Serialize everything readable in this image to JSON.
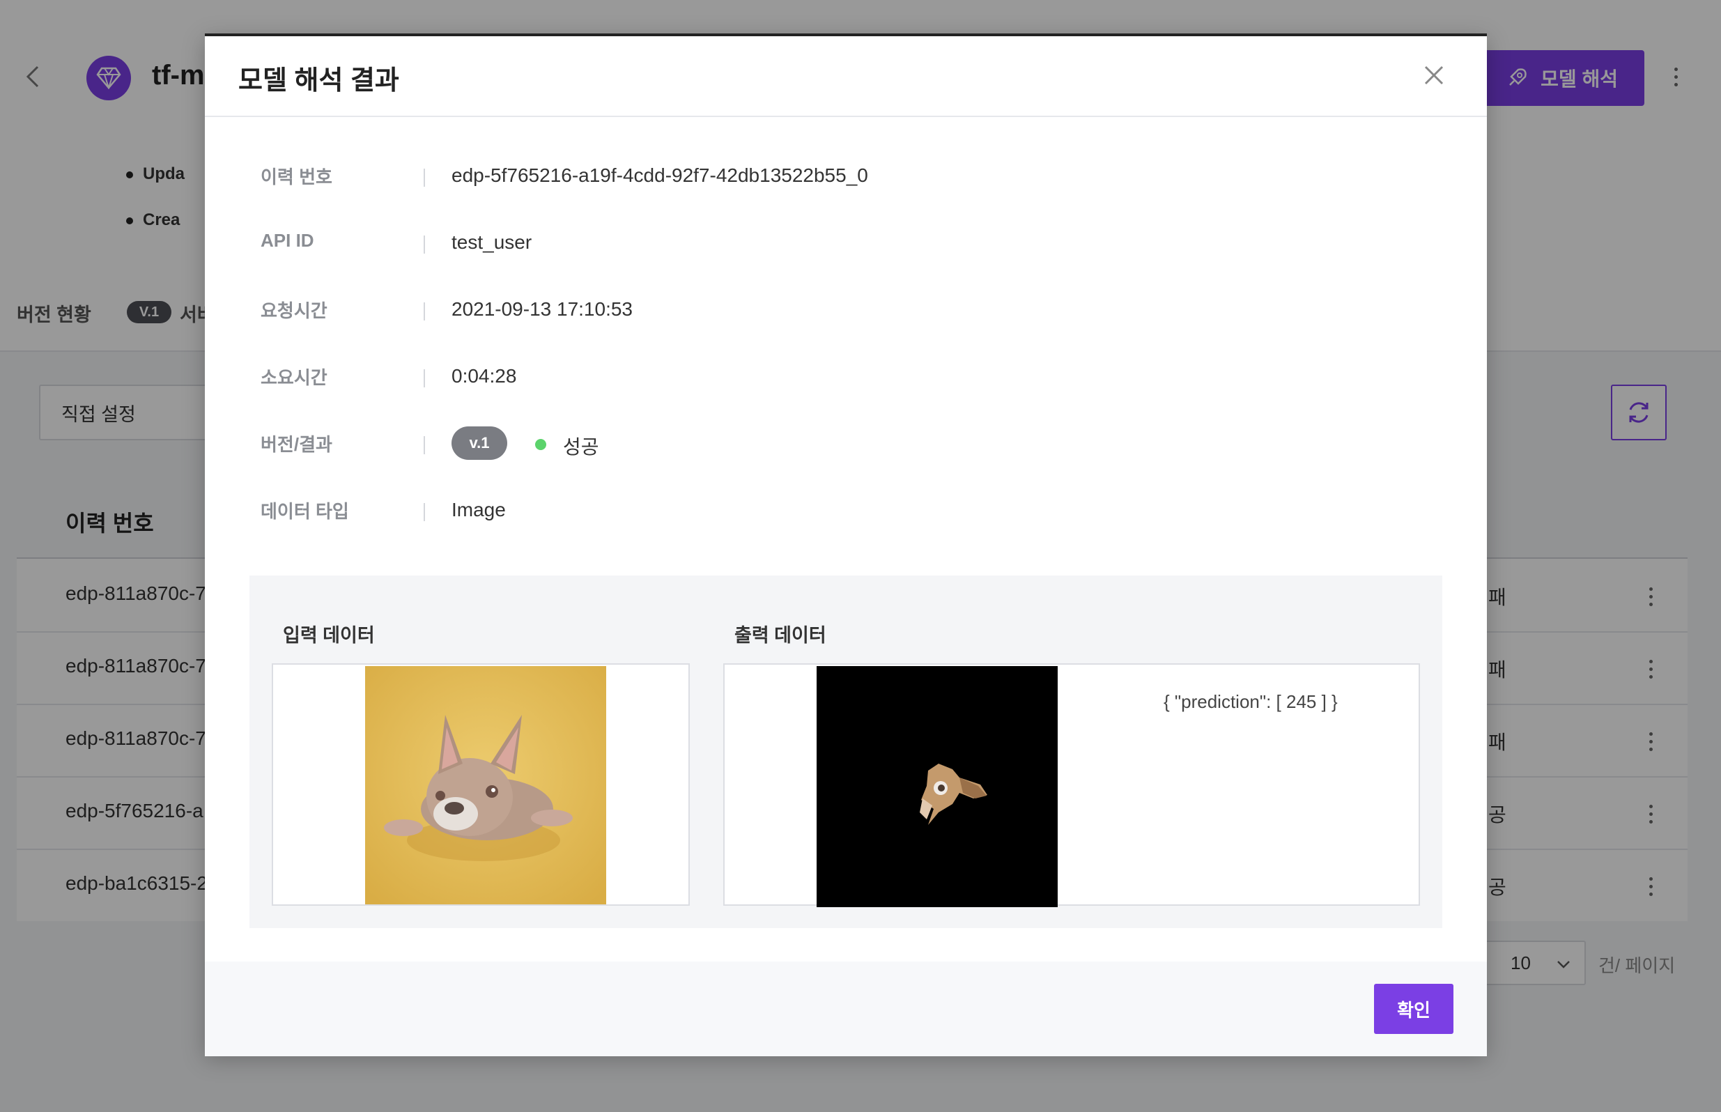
{
  "page": {
    "model_title": "tf-m",
    "meta": [
      "Upda",
      "Crea"
    ],
    "interpret_button": "모델 해석",
    "version_status_label": "버전 현황",
    "version_chip": "V.1",
    "server_label": "서버",
    "filter_select": "직접 설정",
    "table": {
      "header_id": "이력 번호",
      "rows": [
        {
          "id": "edp-811a870c-7",
          "result": "패"
        },
        {
          "id": "edp-811a870c-7",
          "result": "패"
        },
        {
          "id": "edp-811a870c-7",
          "result": "패"
        },
        {
          "id": "edp-5f765216-a",
          "result": "공"
        },
        {
          "id": "edp-ba1c6315-2",
          "result": "공"
        }
      ],
      "page_size": "10",
      "page_size_unit": "건/ 페이지"
    }
  },
  "modal": {
    "title": "모델 해석 결과",
    "fields": [
      {
        "label": "이력 번호",
        "value": "edp-5f765216-a19f-4cdd-92f7-42db13522b55_0"
      },
      {
        "label": "API ID",
        "value": "test_user"
      },
      {
        "label": "요청시간",
        "value": "2021-09-13 17:10:53"
      },
      {
        "label": "소요시간",
        "value": "0:04:28"
      },
      {
        "label": "버전/결과",
        "version": "v.1",
        "status": "성공"
      },
      {
        "label": "데이터 타입",
        "value": "Image"
      }
    ],
    "input_title": "입력 데이터",
    "output_title": "출력 데이터",
    "output_json": "{ \"prediction\": [ 245 ] }",
    "confirm": "확인"
  },
  "colors": {
    "accent": "#7b3fe4",
    "success": "#5bd36b"
  }
}
